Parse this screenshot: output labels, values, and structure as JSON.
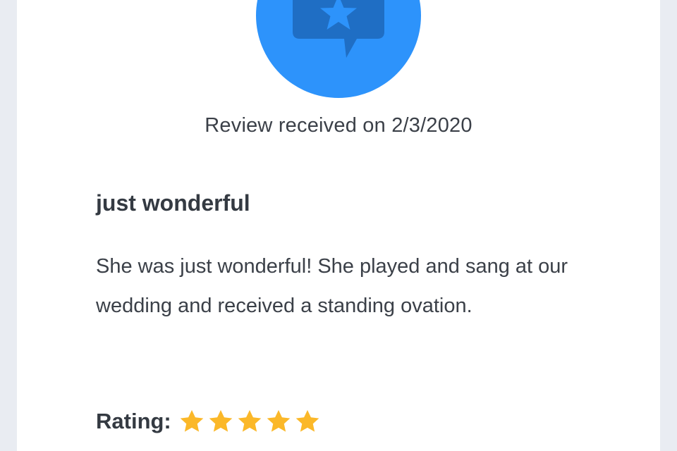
{
  "colors": {
    "page_background": "#e9ecf2",
    "card_background": "#ffffff",
    "badge_blue": "#2d93fb",
    "badge_icon_blue": "#1f6ec4",
    "star_gold": "#fbb829",
    "text_dark": "#3b4048"
  },
  "badge": {
    "icon": "speech-bubble-star-icon"
  },
  "review": {
    "received_text": "Review received on 2/3/2020",
    "title": "just wonderful",
    "body": "She was just wonderful! She played and sang at our wedding and received a standing ovation.",
    "rating_label": "Rating:",
    "rating_value": 5,
    "rating_max": 5,
    "star_icon": "star-icon"
  }
}
